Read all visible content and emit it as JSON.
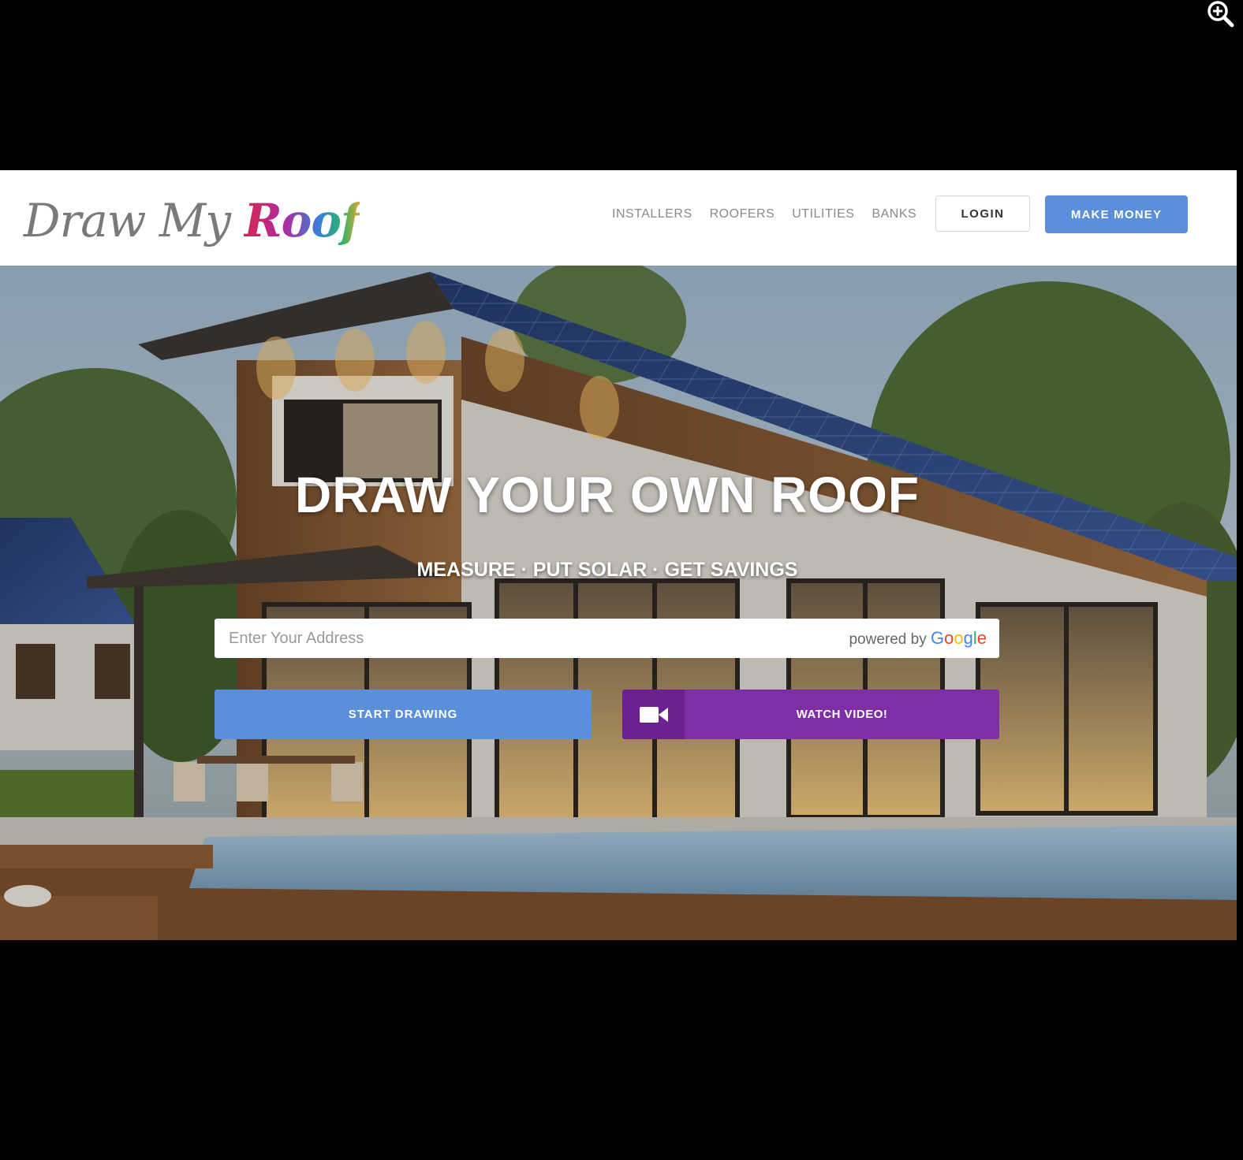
{
  "header": {
    "logo": {
      "word1": "Draw",
      "word2": "My",
      "word3": "Roof"
    },
    "nav": [
      {
        "label": "INSTALLERS"
      },
      {
        "label": "ROOFERS"
      },
      {
        "label": "UTILITIES"
      },
      {
        "label": "BANKS"
      }
    ],
    "login_label": "LOGIN",
    "make_money_label": "MAKE MONEY"
  },
  "hero": {
    "title": "DRAW YOUR OWN ROOF",
    "subtitle": "MEASURE · PUT SOLAR · GET SAVINGS",
    "address_placeholder": "Enter Your Address",
    "powered_by": "powered by",
    "google": "Google",
    "start_drawing_label": "START DRAWING",
    "watch_video_label": "WATCH VIDEO!"
  },
  "icons": {
    "zoom": "zoom-in-icon",
    "video": "video-camera-icon"
  },
  "colors": {
    "primary_blue": "#5b8fd9",
    "video_purple": "#7e2fa6",
    "video_purple_dark": "#6c2191"
  }
}
